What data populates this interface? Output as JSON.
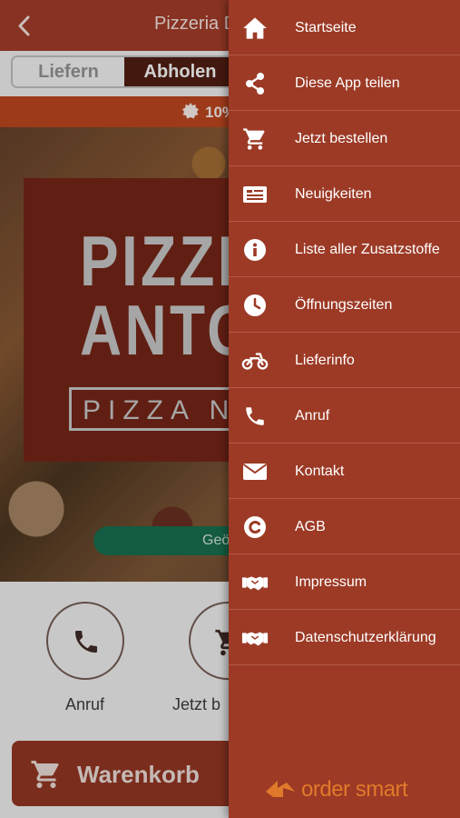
{
  "header": {
    "title": "Pizzeria D"
  },
  "order_mode": {
    "options": [
      "Liefern",
      "Abholen"
    ],
    "selected": "Abholen"
  },
  "promo": {
    "text": "10%"
  },
  "logo": {
    "line1": "PIZZER",
    "line2": "ANTO",
    "subtitle": "PIZZA NA"
  },
  "geo_button": {
    "label": "Geö"
  },
  "actions": [
    {
      "label": "Anruf",
      "icon": "phone-icon"
    },
    {
      "label": "Jetzt b",
      "icon": "cart-icon"
    }
  ],
  "cart": {
    "label": "Warenkorb"
  },
  "menu": {
    "items": [
      {
        "label": "Startseite",
        "icon": "home-icon"
      },
      {
        "label": "Diese App teilen",
        "icon": "share-icon"
      },
      {
        "label": "Jetzt bestellen",
        "icon": "cart-icon"
      },
      {
        "label": "Neuigkeiten",
        "icon": "newspaper-icon"
      },
      {
        "label": "Liste aller Zusatzstoffe",
        "icon": "info-icon"
      },
      {
        "label": "Öffnungszeiten",
        "icon": "clock-icon"
      },
      {
        "label": "Lieferinfo",
        "icon": "motorcycle-icon"
      },
      {
        "label": "Anruf",
        "icon": "phone-icon"
      },
      {
        "label": "Kontakt",
        "icon": "envelope-icon"
      },
      {
        "label": "AGB",
        "icon": "copyright-icon"
      },
      {
        "label": "Impressum",
        "icon": "handshake-icon"
      },
      {
        "label": "Datenschutzerklärung",
        "icon": "handshake-icon"
      }
    ],
    "brand": "order smart"
  },
  "colors": {
    "drawer_bg": "#9c3a26",
    "topbar_bg": "#9a3a27",
    "brand_orange": "#e07a2a"
  }
}
